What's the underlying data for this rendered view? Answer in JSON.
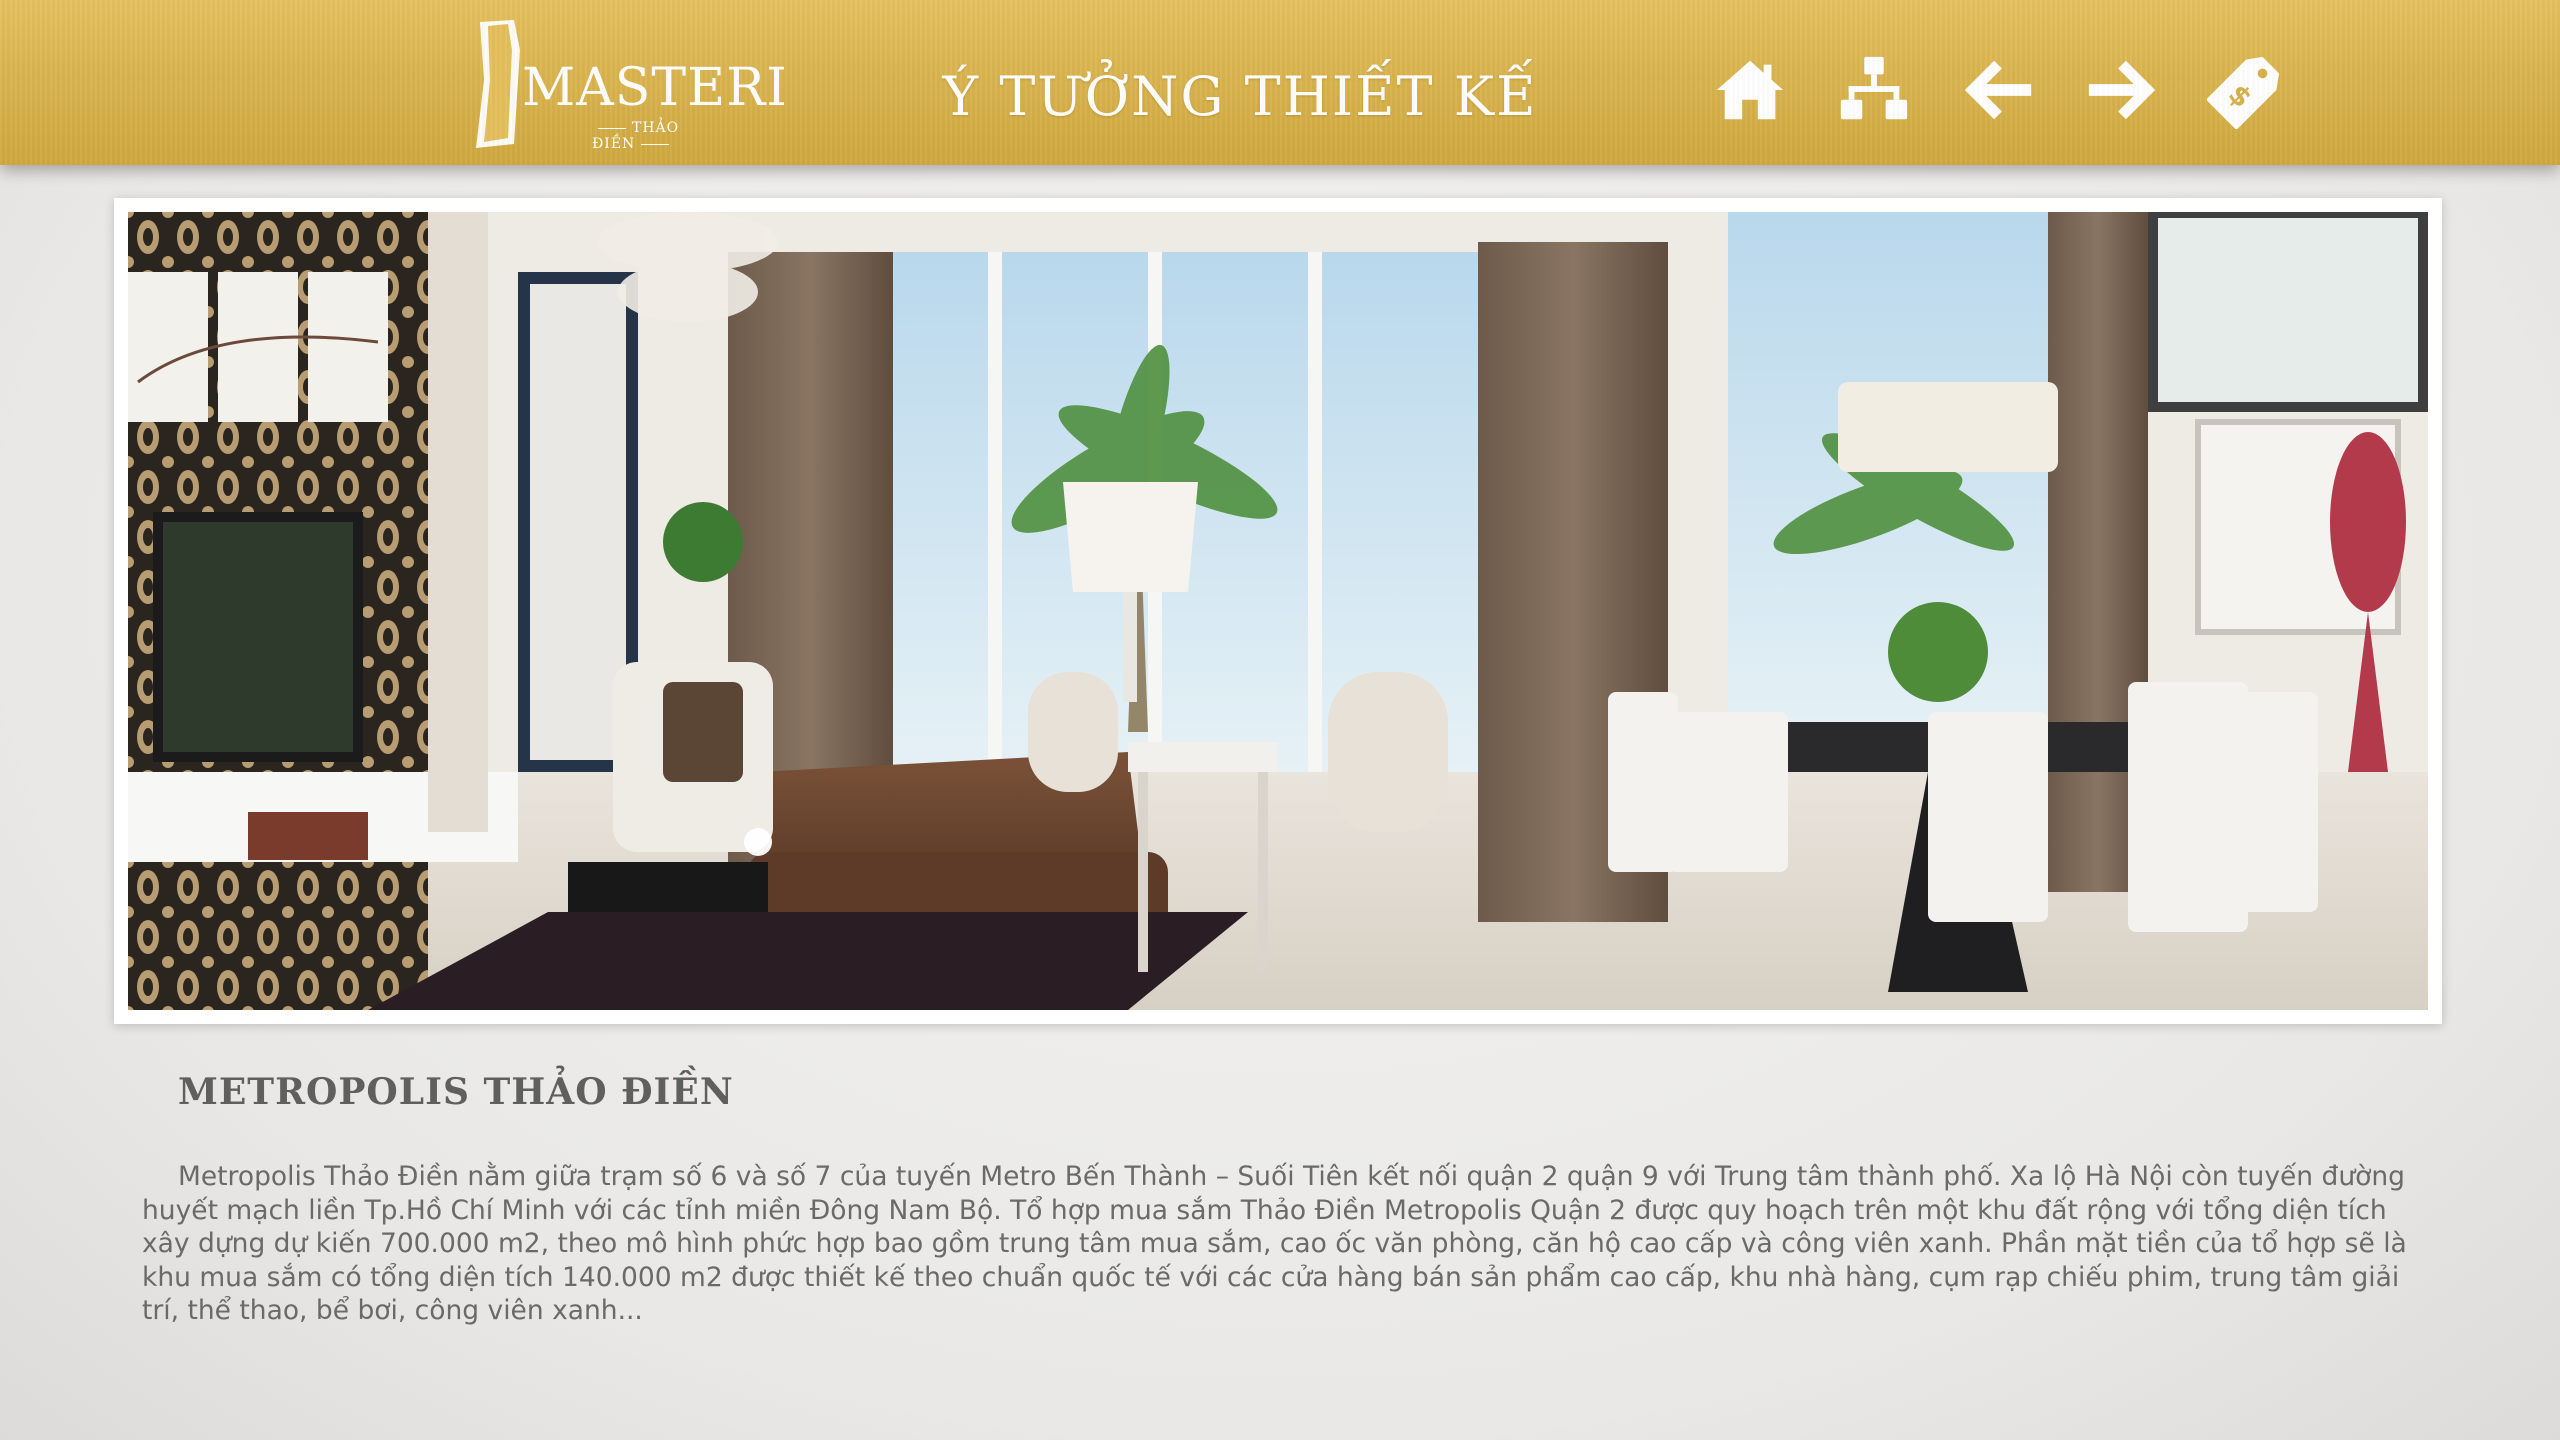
{
  "header": {
    "logo_text": "ASTERI",
    "logo_initial": "M",
    "logo_subtext": "THẢO ĐIỀN",
    "title": "Ý TƯỞNG THIẾT KẾ",
    "nav": [
      {
        "icon": "home-icon"
      },
      {
        "icon": "sitemap-icon"
      },
      {
        "icon": "arrow-left-icon"
      },
      {
        "icon": "arrow-right-icon"
      },
      {
        "icon": "price-tag-icon"
      }
    ]
  },
  "hero": {
    "image": "interior-living-dining-room-render"
  },
  "content": {
    "title": "METROPOLIS THẢO ĐIỀN",
    "body": "Metropolis Thảo Điền nằm giữa trạm số 6 và số 7 của tuyến Metro Bến Thành – Suối Tiên kết nối quận 2 quận 9 với Trung tâm thành phố. Xa lộ Hà Nội còn tuyến đường huyết mạch liền Tp.Hồ Chí Minh với các tỉnh miền Đông Nam Bộ. Tổ hợp mua sắm Thảo Điền Metropolis Quận 2 được quy hoạch trên một khu đất rộng với tổng diện tích xây dựng dự kiến 700.000 m2, theo mô hình phức hợp bao gồm trung tâm mua sắm, cao ốc văn phòng, căn hộ cao cấp và công viên xanh. Phần mặt tiền của tổ hợp sẽ là khu mua sắm có tổng diện tích 140.000 m2 được thiết kế theo chuẩn quốc tế với các cửa hàng bán sản phẩm cao cấp, khu nhà hàng, cụm rạp chiếu phim, trung tâm giải trí, thể thao, bể bơi, công viên xanh..."
  },
  "colors": {
    "header_gold": "#dab44f",
    "background": "#ecebea",
    "text_gray": "#6a6a6a"
  }
}
